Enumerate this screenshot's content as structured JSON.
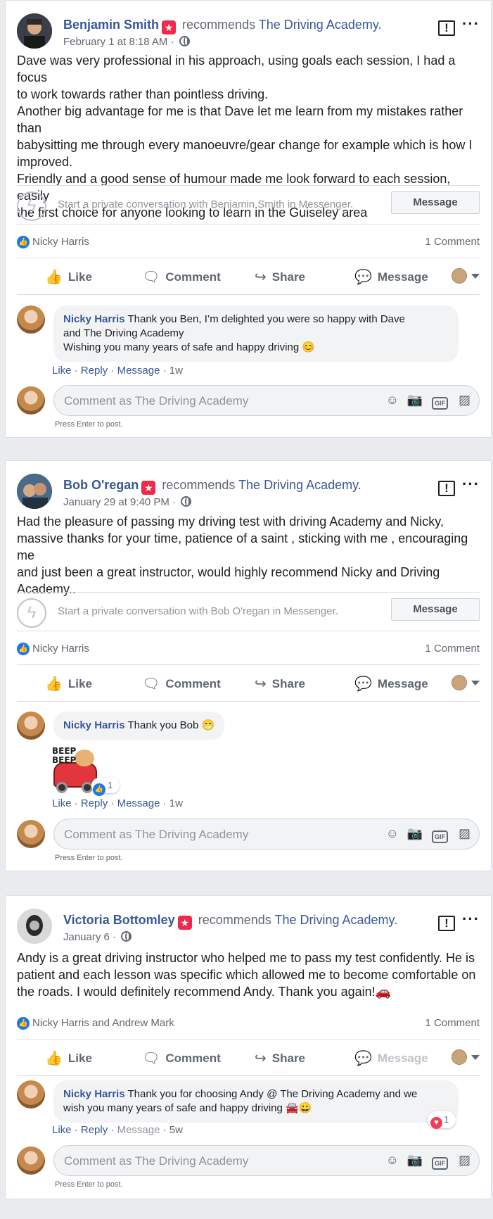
{
  "posts": [
    {
      "author": "Benjamin Smith",
      "recommends": "recommends",
      "page": "The Driving Academy.",
      "date": "February 1 at 8:18 AM ·",
      "body": [
        "Dave was very professional in his approach, using goals each session, I had a focus",
        "to work towards rather than pointless driving.",
        "Another big advantage for me is that Dave let me learn from my mistakes rather than",
        "babysitting me through every manoeuvre/gear change for example which is how I",
        "improved.",
        "Friendly and a good sense of humour made me look forward to each session, easily",
        "the first choice for anyone looking to learn in the Guiseley area"
      ],
      "messenger_text": "Start a private conversation with Benjamin Smith in Messenger.",
      "message_button": "Message",
      "reactors": "Nicky Harris",
      "comment_count": "1 Comment",
      "comment": {
        "name": "Nicky Harris",
        "lines": [
          "Thank you Ben, I’m delighted you were so happy with Dave",
          "and The Driving Academy",
          "Wishing you many years of safe and happy driving 😊"
        ],
        "time": "1w"
      }
    },
    {
      "author": "Bob O'regan",
      "recommends": "recommends",
      "page": "The Driving Academy.",
      "date": "January 29 at 9:40 PM ·",
      "body": [
        "Had the pleasure of passing my driving test with driving Academy and Nicky,",
        "massive thanks for your time, patience of a saint , sticking with me , encouraging me",
        "and just been a great instructor, would highly recommend Nicky and Driving",
        "Academy.."
      ],
      "messenger_text": "Start a private conversation with Bob O'regan in Messenger.",
      "message_button": "Message",
      "reactors": "Nicky Harris",
      "comment_count": "1 Comment",
      "comment": {
        "name": "Nicky Harris",
        "lines": [
          "Thank you Bob 😁"
        ],
        "time": "1w",
        "sticker_text": "BEEP BEEP",
        "sticker_likes": "1"
      }
    },
    {
      "author": "Victoria Bottomley",
      "recommends": "recommends",
      "page": "The Driving Academy.",
      "date": "January 6 ·",
      "body": [
        "Andy is a great driving instructor who helped me to pass my test confidently. He is",
        "patient and each lesson was specific which allowed me to become comfortable on",
        "the roads. I would definitely recommend Andy. Thank you again!🚗"
      ],
      "reactors": "Nicky Harris and Andrew Mark",
      "comment_count": "1 Comment",
      "comment": {
        "name": "Nicky Harris",
        "lines": [
          "Thank you for choosing Andy @ The Driving Academy and we",
          "wish you many years of safe and happy driving 🚘😀"
        ],
        "time": "5w",
        "heart_count": "1"
      }
    }
  ],
  "actions": {
    "like": "Like",
    "comment": "Comment",
    "share": "Share",
    "message": "Message"
  },
  "comment_links": {
    "like": "Like",
    "reply": "Reply",
    "message": "Message"
  },
  "composer": {
    "placeholder": "Comment as The Driving Academy",
    "hint": "Press Enter to post."
  },
  "icons": [
    "star-badge-icon",
    "globe-icon",
    "report-icon",
    "more-icon",
    "messenger-icon",
    "like-icon",
    "comment-icon",
    "share-icon",
    "message-icon",
    "emoji-icon",
    "camera-icon",
    "gif-icon",
    "sticker-icon",
    "heart-icon"
  ],
  "colors": {
    "link": "#385898",
    "accent": "#1877f2",
    "star": "#f02849",
    "text": "#1c1e21",
    "muted": "#606770"
  }
}
